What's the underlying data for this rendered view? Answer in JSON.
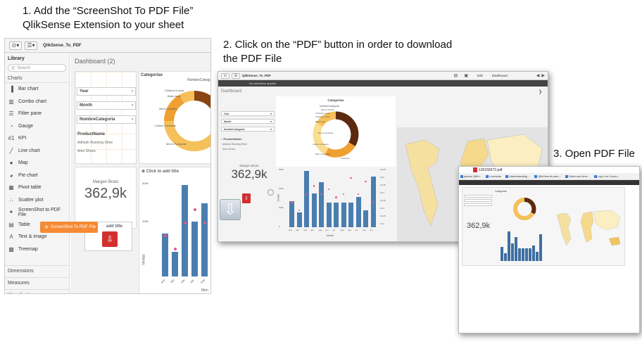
{
  "steps": {
    "step1_line1": "1. Add the “ScreenShot To PDF File”",
    "step1_line2": "QlikSense Extension to your sheet",
    "step2_line1": "2. Click on the “PDF” button in order to download",
    "step2_line2": "the PDF File",
    "step3": "3. Open PDF File"
  },
  "shot1": {
    "app_title": "QlikSense_To_PDF",
    "library_title": "Library",
    "search_placeholder": "Search",
    "charts_header": "Charts",
    "items": [
      {
        "icon": "bar-chart-icon",
        "glyph": "▐",
        "label": "Bar chart"
      },
      {
        "icon": "combo-chart-icon",
        "glyph": "▥",
        "label": "Combo chart"
      },
      {
        "icon": "filter-pane-icon",
        "glyph": "☰",
        "label": "Filter pane"
      },
      {
        "icon": "gauge-icon",
        "glyph": "◔",
        "label": "Gauge"
      },
      {
        "icon": "kpi-icon",
        "glyph": "#1",
        "label": "KPI"
      },
      {
        "icon": "line-chart-icon",
        "glyph": "╱",
        "label": "Line chart"
      },
      {
        "icon": "map-icon",
        "glyph": "●",
        "label": "Map"
      },
      {
        "icon": "pie-chart-icon",
        "glyph": "◕",
        "label": "Pie chart"
      },
      {
        "icon": "pivot-table-icon",
        "glyph": "▦",
        "label": "Pivot table"
      },
      {
        "icon": "scatter-plot-icon",
        "glyph": "∴",
        "label": "Scatter plot"
      },
      {
        "icon": "screenshot-pdf-icon",
        "glyph": "✦",
        "label": "ScreenShot to PDF File"
      },
      {
        "icon": "table-icon",
        "glyph": "▤",
        "label": "Table"
      },
      {
        "icon": "text-image-icon",
        "glyph": "A",
        "label": "Text & image"
      },
      {
        "icon": "treemap-icon",
        "glyph": "▩",
        "label": "Treemap"
      }
    ],
    "bottom_sections": [
      "Dimensions",
      "Measures",
      "Visualizations"
    ],
    "sheet_title": "Dashboard (2)",
    "filters": [
      "Year",
      "Month",
      "NombreCategoria"
    ],
    "product_header": "ProductName",
    "products": [
      "Adhesh Running Shoe",
      "Amo Shoes"
    ],
    "pie_title": "Categorias",
    "pie_header": "NombreCatego",
    "pie_labels": [
      "Children's wear",
      "Baby wear",
      "Men's Clothes",
      "Ladies' Footwear",
      "Men's Footwear"
    ],
    "kpi_label": "Margen Bruto",
    "kpi_value": "362,9k",
    "chart_placeholder": "Click to add title",
    "chart_placeholder2": "add title",
    "y_axis_label": "Ventas",
    "y_tick_top": "300k",
    "y_tick_mid": "200k",
    "x_tick_labels": [
      "ene",
      "feb",
      "mar",
      "abr",
      "may"
    ],
    "x_axis_label": "Mon",
    "drag_tooltip": "ScreenShot To PDF File"
  },
  "shot2": {
    "app_title": "QlikSense_To_PDF",
    "selections_text": "No selections applied",
    "sheet_title": "Dashboard",
    "sheet_selector": "Dashboard",
    "edit_label": "Edit",
    "filters": [
      "Year",
      "Month",
      "NombreCategoria"
    ],
    "product_header": "ProductName",
    "products": [
      "Adhesh Running Shoe",
      "Amo Shoes"
    ],
    "pie_title": "Categorias",
    "pie_header": "NombreCategoria",
    "pie_labels": [
      "Men's Clothes",
      "Children's wear",
      "Children's wear",
      "Baby wear",
      "Men's Footwear",
      "Ladies' Footwear",
      "Men's Footwear",
      "Footwear"
    ],
    "kpi_label": "Margen Bruto",
    "kpi_value": "362,9k",
    "y_ticks": [
      "300k",
      "200k",
      "100k",
      "0"
    ],
    "y_axis_label": "Ventas",
    "y2_ticks": [
      "31,55",
      "31,5",
      "31,45",
      "31,4",
      "31,35",
      "31,3",
      "31,25",
      "31,2"
    ],
    "x_axis_label": "Month",
    "pdf_icon_label": "PDF"
  },
  "shot3": {
    "filename": "130155572.pdf",
    "bookmarks": [
      "yectos QlikV...",
      "Licencias",
      "Understanding ...",
      "QlikView eLearn...",
      "Order and Inve...",
      "Log in to Concu..."
    ],
    "kpi_value": "362,9k",
    "pie_title": "Categorias"
  },
  "chart_data": [
    {
      "type": "bar",
      "title": "",
      "categories": [
        "ene",
        "feb",
        "mar",
        "abr",
        "may",
        "jun",
        "jul",
        "ago",
        "sep",
        "oct",
        "nov",
        "dic"
      ],
      "series": [
        {
          "values": [
            140,
            80,
            300,
            180,
            240,
            130,
            130,
            130,
            130,
            160,
            90,
            270
          ]
        },
        {
          "values": [
            31.35,
            31.3,
            31.4,
            31.45,
            31.4,
            31.43,
            31.38,
            31.4,
            31.5,
            31.4,
            31.48,
            31.35
          ]
        }
      ],
      "ylabel": "Ventas",
      "xlabel": "Month",
      "ylim": [
        0,
        300
      ],
      "y2lim": [
        31.2,
        31.55
      ],
      "colors": [
        "#4a7eb0",
        "#e05a8d"
      ]
    },
    {
      "type": "pie",
      "title": "Categorias",
      "categories": [
        "Men's Clothes",
        "Children's wear",
        "Baby wear",
        "Men's Footwear",
        "Ladies' Footwear",
        "Footwear"
      ],
      "values": [
        30,
        14,
        12,
        18,
        14,
        12
      ],
      "colors": [
        "#5b2a10",
        "#8a4412",
        "#c06a1a",
        "#f0a030",
        "#f5c05a",
        "#f9dd90"
      ]
    }
  ]
}
